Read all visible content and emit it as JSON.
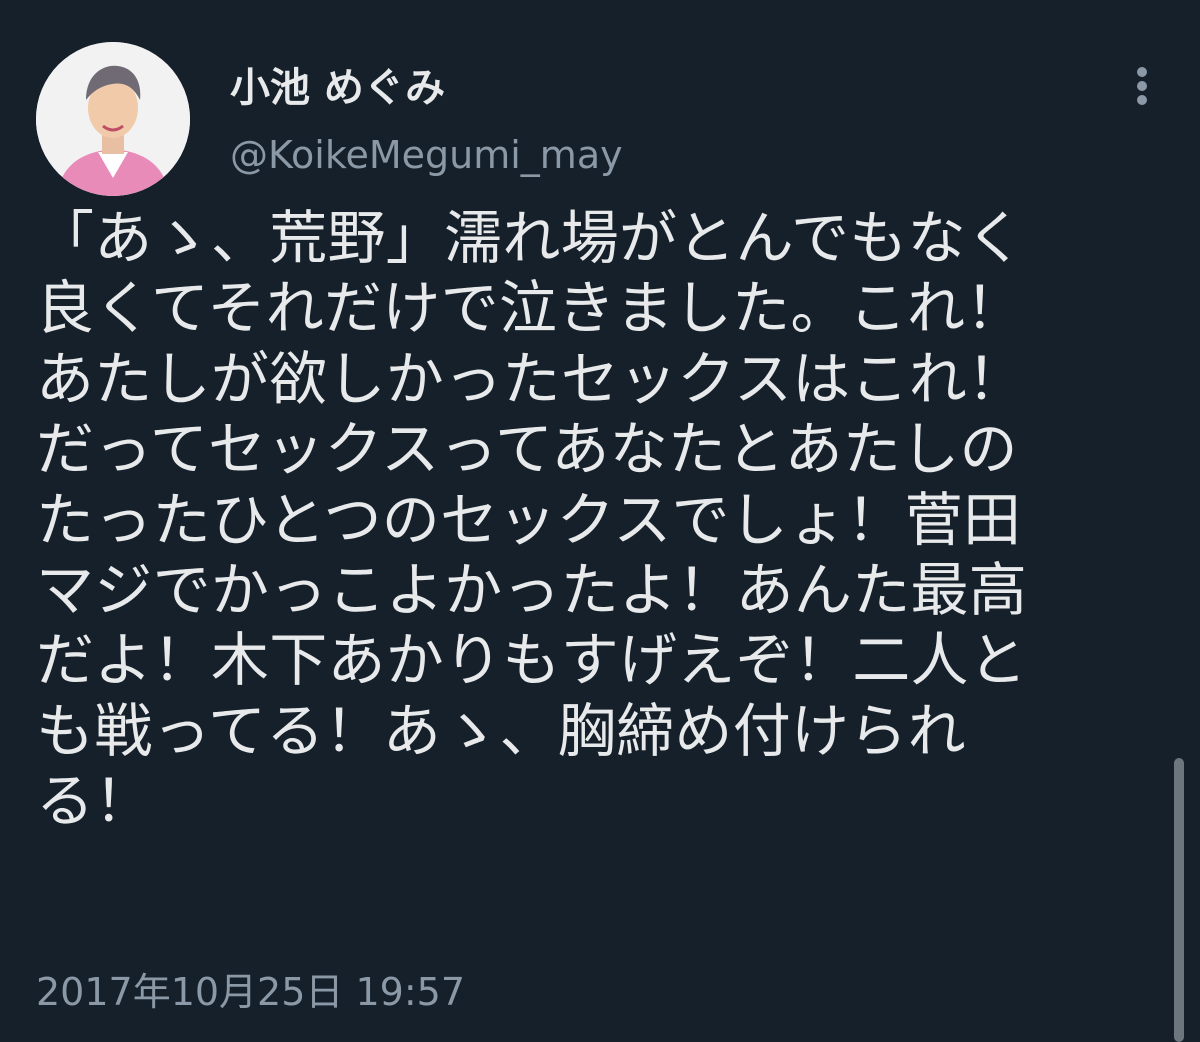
{
  "author": {
    "name": "小池 めぐみ",
    "handle": "@KoikeMegumi_may"
  },
  "tweet": {
    "lines": [
      "「あゝ、荒野」濡れ場がとんでもなく",
      "良くてそれだけで泣きました。これ！",
      "あたしが欲しかったセックスはこれ！",
      "だってセックスってあなたとあたしの",
      "たったひとつのセックスでしょ！菅田",
      "マジでかっこよかったよ！あんた最高",
      "だよ！木下あかりもすげえぞ！二人と",
      "も戦ってる！あゝ、胸締め付けられ",
      "る！"
    ],
    "timestamp": "2017年10月25日 19:57"
  },
  "icons": {
    "more": "more-options-icon",
    "avatar": "profile-photo"
  },
  "colors": {
    "background": "#15202b",
    "primary_text": "#e7e9ea",
    "secondary_text": "#8b98a5"
  }
}
